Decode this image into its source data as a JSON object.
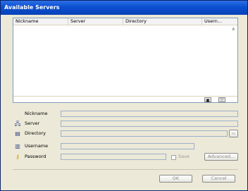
{
  "window": {
    "title": "Available Servers"
  },
  "list": {
    "columns": [
      "Nickname",
      "Server",
      "Directory",
      "Usern..."
    ],
    "toolbar_icons": [
      "add-icon",
      "delete-icon"
    ]
  },
  "form": {
    "nickname_label": "Nickname",
    "server_label": "Server",
    "directory_label": "Directory",
    "username_label": "Username",
    "password_label": "Password",
    "save_label": "Save",
    "advanced_label": "Advanced...",
    "icons": {
      "server": "server-icon",
      "directory": "folder-icon",
      "username": "user-icon",
      "password": "key-icon",
      "browse": "browse-folder-icon"
    }
  },
  "buttons": {
    "ok": "OK",
    "cancel": "Cancel"
  }
}
